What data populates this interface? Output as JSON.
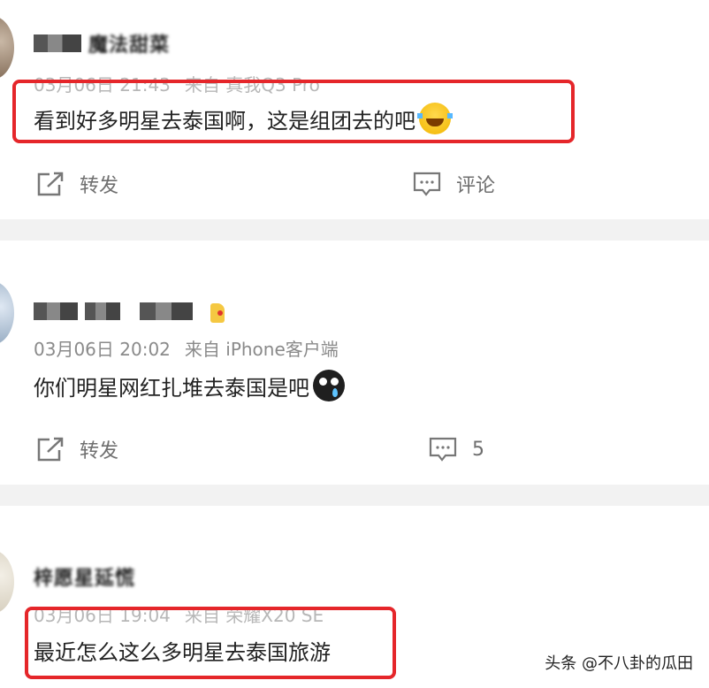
{
  "posts": [
    {
      "username": "魔法甜菜",
      "time": "03月06日 21:43",
      "source_label": "来自",
      "device": "真我Q3 Pro",
      "text": "看到好多明星去泰国啊，这是组团去的吧",
      "emoji": "laugh-cry-emoji",
      "repost_label": "转发",
      "comment_label": "评论"
    },
    {
      "username": "",
      "time": "03月06日 20:02",
      "source_label": "来自",
      "device": "iPhone客户端",
      "text": "你们明星网红扎堆去泰国是吧",
      "emoji": "cry-emoji",
      "repost_label": "转发",
      "comment_count": "5"
    },
    {
      "username": "梓愿星延慌",
      "time": "03月06日 19:04",
      "source_label": "来自",
      "device": "荣耀X20 SE",
      "text": "最近怎么这么多明星去泰国旅游"
    }
  ],
  "watermark": "头条 @不八卦的瓜田",
  "colors": {
    "highlight": "#e5262a",
    "separator": "#f2f2f2",
    "meta_text": "#8a8a8a",
    "body_text": "#222222"
  }
}
